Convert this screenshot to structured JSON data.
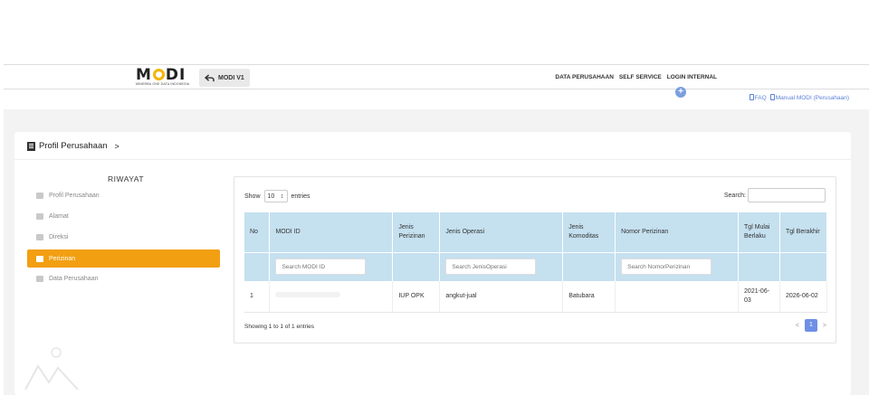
{
  "header": {
    "logo_word_pre": "M",
    "logo_word_post": "DI",
    "logo_tagline": "MINERBA ONE DATA INDONESIA",
    "back_button_label": "MODI V1",
    "nav": [
      "DATA PERUSAHAAN",
      "SELF SERVICE",
      "LOGIN INTERNAL"
    ]
  },
  "help_links": {
    "faq": "FAQ",
    "manual": "Manual MODI (Perusahaan)"
  },
  "breadcrumb": {
    "label": "Profil Perusahaan",
    "chevron": ">"
  },
  "sidebar": {
    "title": "RIWAYAT",
    "items": [
      {
        "label": "Profil Perusahaan",
        "active": false
      },
      {
        "label": "Alamat",
        "active": false
      },
      {
        "label": "Direksi",
        "active": false
      },
      {
        "label": "Perizinan",
        "active": true
      },
      {
        "label": "Data Perusahaan",
        "active": false
      }
    ]
  },
  "table_controls": {
    "show_label": "Show",
    "entries_value": "10",
    "entries_label": "entries",
    "search_label": "Search:"
  },
  "table": {
    "headers": [
      "No",
      "MODI ID",
      "Jenis Perizinan",
      "Jenis Operasi",
      "Jenis Komoditas",
      "Nomor Perizinan",
      "Tgl Mulai Berlaku",
      "Tgl Berakhir"
    ],
    "filters": {
      "modi_id": "Search MODI ID",
      "jenis_operasi": "Search JenisOperasi",
      "nomor_perizinan": "Search NomorPerizinan"
    },
    "rows": [
      {
        "no": "1",
        "modi_id": "",
        "jenis_perizinan": "IUP OPK",
        "jenis_operasi": "angkut-jual",
        "jenis_komoditas": "Batubara",
        "nomor_perizinan": "",
        "tgl_mulai": "2021-06-03",
        "tgl_berakhir": "2026-06-02"
      }
    ]
  },
  "footer": {
    "info": "Showing 1 to 1 of 1 entries",
    "prev": "<",
    "page": "1",
    "next": ">"
  },
  "colors": {
    "accent": "#f29f12",
    "table_header": "#c5e0ef",
    "link": "#5b82d9",
    "page_active": "#6d8fe6"
  }
}
